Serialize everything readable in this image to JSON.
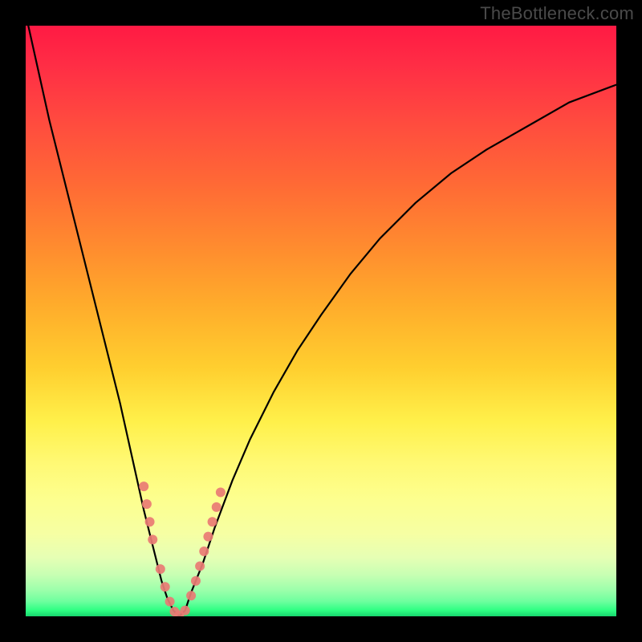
{
  "watermark": "TheBottleneck.com",
  "colors": {
    "background_frame": "#000000",
    "curve": "#000000",
    "marker_fill": "#e97b74",
    "marker_stroke": "#e97b74"
  },
  "chart_data": {
    "type": "line",
    "title": "",
    "xlabel": "",
    "ylabel": "",
    "xlim": [
      0,
      100
    ],
    "ylim": [
      0,
      100
    ],
    "grid": false,
    "legend": false,
    "series": [
      {
        "name": "bottleneck-curve",
        "x": [
          0,
          2,
          4,
          6,
          8,
          10,
          12,
          14,
          16,
          18,
          20,
          21,
          22,
          23,
          24,
          25,
          26,
          27,
          28,
          30,
          32,
          35,
          38,
          42,
          46,
          50,
          55,
          60,
          66,
          72,
          78,
          85,
          92,
          100
        ],
        "y": [
          102,
          93,
          84,
          76,
          68,
          60,
          52,
          44,
          36,
          27,
          18,
          14,
          10,
          6,
          3,
          1,
          0,
          1,
          4,
          9,
          15,
          23,
          30,
          38,
          45,
          51,
          58,
          64,
          70,
          75,
          79,
          83,
          87,
          90
        ]
      }
    ],
    "markers": [
      {
        "x": 20.0,
        "y": 22
      },
      {
        "x": 20.5,
        "y": 19
      },
      {
        "x": 21.0,
        "y": 16
      },
      {
        "x": 21.5,
        "y": 13
      },
      {
        "x": 22.8,
        "y": 8
      },
      {
        "x": 23.6,
        "y": 5
      },
      {
        "x": 24.4,
        "y": 2.5
      },
      {
        "x": 25.2,
        "y": 0.8
      },
      {
        "x": 26.0,
        "y": 0.2
      },
      {
        "x": 27.0,
        "y": 1.0
      },
      {
        "x": 28.0,
        "y": 3.5
      },
      {
        "x": 28.8,
        "y": 6
      },
      {
        "x": 29.5,
        "y": 8.5
      },
      {
        "x": 30.2,
        "y": 11
      },
      {
        "x": 30.9,
        "y": 13.5
      },
      {
        "x": 31.6,
        "y": 16
      },
      {
        "x": 32.3,
        "y": 18.5
      },
      {
        "x": 33.0,
        "y": 21
      }
    ],
    "marker_radius_px": 6
  }
}
